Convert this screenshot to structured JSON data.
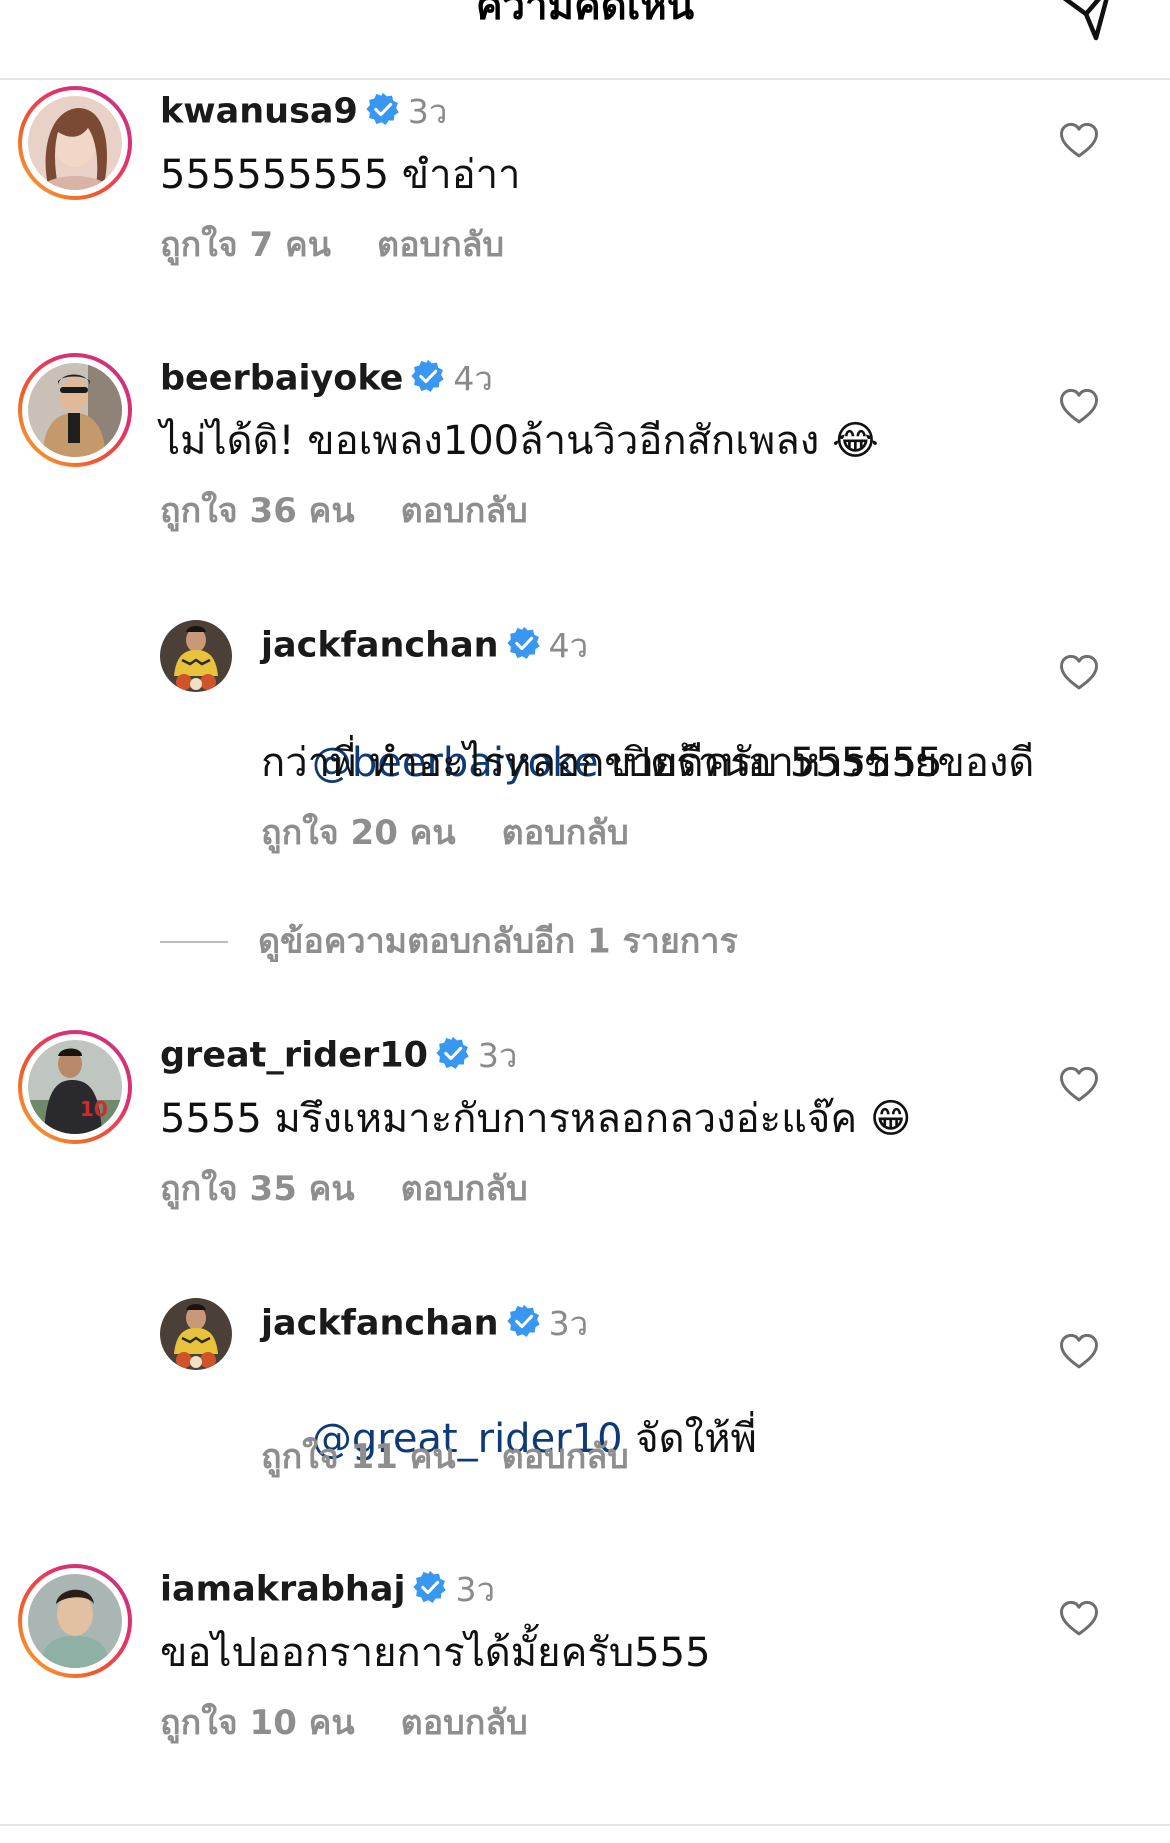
{
  "header": {
    "title": "ความคิดเห็น",
    "send_icon": "send-icon"
  },
  "comments": [
    {
      "username": "kwanusa9",
      "verified": true,
      "time": "3ว",
      "text": "555555555 ขำอ่าา",
      "likes": "ถูกใจ 7 คน",
      "reply": "ตอบกลับ"
    },
    {
      "username": "beerbaiyoke",
      "verified": true,
      "time": "4ว",
      "text": "ไม่ได้ดิ! ขอเพลง100ล้านวิวอีกสักเพลง 😂",
      "likes": "ถูกใจ 36 คน",
      "reply": "ตอบกลับ"
    },
    {
      "username": "jackfanchan",
      "verified": true,
      "time": "4ว",
      "mention": "@beerbaiyoke",
      "text_line1": " เปิดร้านอาหารขายของดี",
      "text_line2": "กว่าพี่ ทำอะไรหลอกขายดีครับ 555555",
      "likes": "ถูกใจ 20 คน",
      "reply": "ตอบกลับ"
    },
    {
      "username": "great_rider10",
      "verified": true,
      "time": "3ว",
      "text": "5555 มรึงเหมาะกับการหลอกลวงอ่ะแจ๊ค 😁",
      "likes": "ถูกใจ 35 คน",
      "reply": "ตอบกลับ"
    },
    {
      "username": "jackfanchan",
      "verified": true,
      "time": "3ว",
      "mention": "@great_rider10",
      "text": " จัดให้พี่",
      "likes": "ถูกใจ 11 คน",
      "reply": "ตอบกลับ"
    },
    {
      "username": "iamakrabhaj",
      "verified": true,
      "time": "3ว",
      "text": "ขอไปออกรายการได้มั้ยครับ555",
      "likes": "ถูกใจ 10 คน",
      "reply": "ตอบกลับ"
    }
  ],
  "view_more_replies": "ดูข้อความตอบกลับอีก 1 รายการ",
  "colors": {
    "verified": "#3897f0",
    "mention": "#0f3a78",
    "muted": "#8e8e8e"
  }
}
